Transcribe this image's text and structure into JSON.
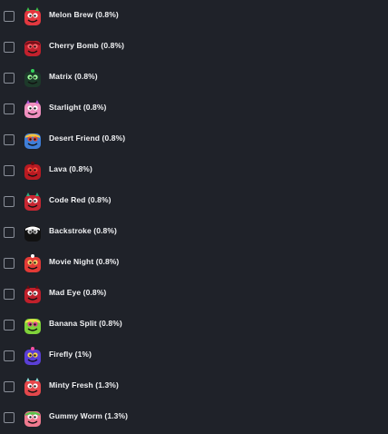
{
  "items": [
    {
      "label": "Melon Brew (0.8%)",
      "icon": "melon-brew-icon",
      "colors": {
        "body": "#e2383f",
        "accent": "#3fbf4a",
        "detail": "#ffffff"
      }
    },
    {
      "label": "Cherry Bomb (0.8%)",
      "icon": "cherry-bomb-icon",
      "colors": {
        "body": "#c2212d",
        "accent": "#7a0f18",
        "detail": "#ff6b70"
      }
    },
    {
      "label": "Matrix (0.8%)",
      "icon": "matrix-icon",
      "colors": {
        "body": "#1d3a2a",
        "accent": "#33d35b",
        "detail": "#9cff9c"
      }
    },
    {
      "label": "Starlight (0.8%)",
      "icon": "starlight-icon",
      "colors": {
        "body": "#f08fbf",
        "accent": "#b65bd6",
        "detail": "#ffffff"
      }
    },
    {
      "label": "Desert Friend (0.8%)",
      "icon": "desert-friend-icon",
      "colors": {
        "body": "#3f7ed8",
        "accent": "#f2c13a",
        "detail": "#e04a3a"
      }
    },
    {
      "label": "Lava (0.8%)",
      "icon": "lava-icon",
      "colors": {
        "body": "#b81a22",
        "accent": "#5e0c10",
        "detail": "#ff4b3a"
      }
    },
    {
      "label": "Code Red (0.8%)",
      "icon": "code-red-icon",
      "colors": {
        "body": "#c72732",
        "accent": "#2fae82",
        "detail": "#ffffff"
      }
    },
    {
      "label": "Backstroke (0.8%)",
      "icon": "backstroke-icon",
      "colors": {
        "body": "#111111",
        "accent": "#ffffff",
        "detail": "#d9d9d9"
      }
    },
    {
      "label": "Movie Night (0.8%)",
      "icon": "movie-night-icon",
      "colors": {
        "body": "#e23a36",
        "accent": "#ffffff",
        "detail": "#f6d36b"
      }
    },
    {
      "label": "Mad Eye (0.8%)",
      "icon": "mad-eye-icon",
      "colors": {
        "body": "#c0202b",
        "accent": "#6a0c12",
        "detail": "#ffffff"
      }
    },
    {
      "label": "Banana Split (0.8%)",
      "icon": "banana-split-icon",
      "colors": {
        "body": "#7fd23a",
        "accent": "#f1e04a",
        "detail": "#e0448f"
      }
    },
    {
      "label": "Firefly (1%)",
      "icon": "firefly-icon",
      "colors": {
        "body": "#5a3fd6",
        "accent": "#f44fa0",
        "detail": "#ffd84a"
      }
    },
    {
      "label": "Minty Fresh (1.3%)",
      "icon": "minty-fresh-icon",
      "colors": {
        "body": "#e4484c",
        "accent": "#8be3dc",
        "detail": "#ffffff"
      }
    },
    {
      "label": "Gummy Worm (1.3%)",
      "icon": "gummy-worm-icon",
      "colors": {
        "body": "#f07a8f",
        "accent": "#59c24a",
        "detail": "#ffffff"
      }
    }
  ]
}
